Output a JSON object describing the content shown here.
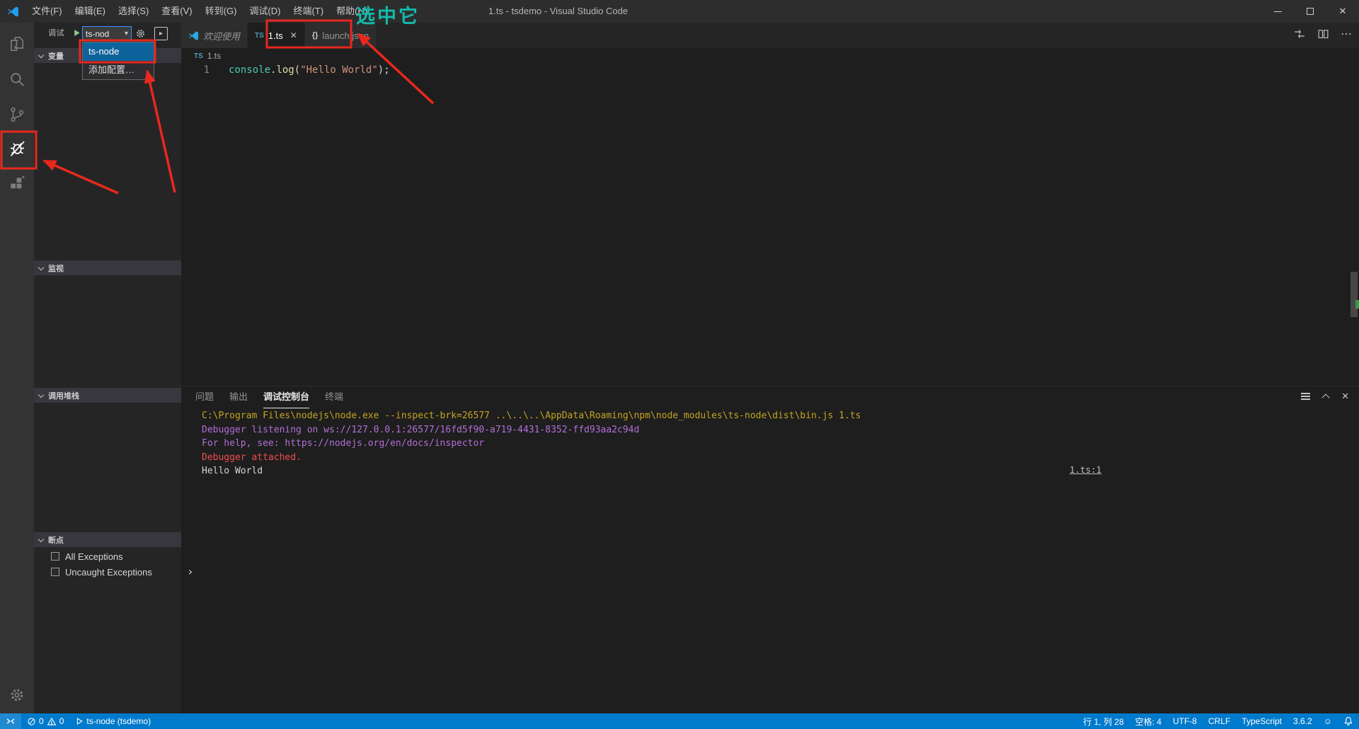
{
  "colors": {
    "statusbar_blue": "#007acc",
    "annotation_red": "#e8281e",
    "annotation_teal": "#14b9aa",
    "dropdown_selection_blue": "#0e639c"
  },
  "window": {
    "title": "1.ts - tsdemo - Visual Studio Code"
  },
  "annotations": {
    "select_it": "选中它"
  },
  "icons": {
    "close": "✕",
    "more_actions": "⋯",
    "dropdown_caret": "▾",
    "smiley": "☺",
    "repl_prompt": "›",
    "ts_badge": "TS",
    "json_badge": "{}",
    "console_btn_glyph": "▸"
  },
  "menus": [
    {
      "label": "文件(F)"
    },
    {
      "label": "编辑(E)"
    },
    {
      "label": "选择(S)"
    },
    {
      "label": "查看(V)"
    },
    {
      "label": "转到(G)"
    },
    {
      "label": "调试(D)"
    },
    {
      "label": "终端(T)"
    },
    {
      "label": "帮助(H)"
    }
  ],
  "sidebar": {
    "view_title": "调试",
    "config_select_value": "ts-nod",
    "dropdown_items": [
      {
        "label": "ts-node"
      },
      {
        "label": "添加配置…"
      }
    ],
    "sections": [
      {
        "label": "变量"
      },
      {
        "label": "监视"
      },
      {
        "label": "调用堆栈"
      },
      {
        "label": "断点"
      }
    ],
    "breakpoint_items": [
      {
        "label": "All Exceptions",
        "checked": false
      },
      {
        "label": "Uncaught Exceptions",
        "checked": false
      }
    ]
  },
  "editor": {
    "tabs": [
      {
        "label": "欢迎使用"
      },
      {
        "label": "1.ts",
        "active": true
      },
      {
        "label": "launch.json"
      }
    ],
    "breadcrumb_file": "1.ts",
    "line_number": "1",
    "code_tokens": [
      {
        "text": "console",
        "type": "builtin"
      },
      {
        "text": ".",
        "type": "punct"
      },
      {
        "text": "log",
        "type": "method"
      },
      {
        "text": "(",
        "type": "punct"
      },
      {
        "text": "\"Hello World\"",
        "type": "string"
      },
      {
        "text": ")",
        "type": "punct"
      },
      {
        "text": ";",
        "type": "punct"
      }
    ]
  },
  "panel": {
    "tabs": [
      {
        "label": "问题"
      },
      {
        "label": "输出"
      },
      {
        "label": "调试控制台",
        "active": true
      },
      {
        "label": "终端"
      }
    ],
    "console_lines": [
      {
        "text": "C:\\Program Files\\nodejs\\node.exe --inspect-brk=26577 ..\\..\\..\\AppData\\Roaming\\npm\\node_modules\\ts-node\\dist\\bin.js 1.ts",
        "color": "yellow"
      },
      {
        "text": "Debugger listening on ws://127.0.0.1:26577/16fd5f90-a719-4431-8352-ffd93aa2c94d",
        "color": "purple"
      },
      {
        "text": "For help, see: https://nodejs.org/en/docs/inspector",
        "color": "purple"
      },
      {
        "text": "Debugger attached.",
        "color": "red"
      },
      {
        "text": "Hello World",
        "color": "plain"
      }
    ],
    "source_link": "1.ts:1"
  },
  "statusbar": {
    "error_count": "0",
    "warning_count": "0",
    "debug_config": "ts-node (tsdemo)",
    "cursor_position": "行 1, 列 28",
    "indentation": "空格: 4",
    "encoding": "UTF-8",
    "line_ending": "CRLF",
    "language": "TypeScript",
    "ts_version": "3.6.2"
  }
}
